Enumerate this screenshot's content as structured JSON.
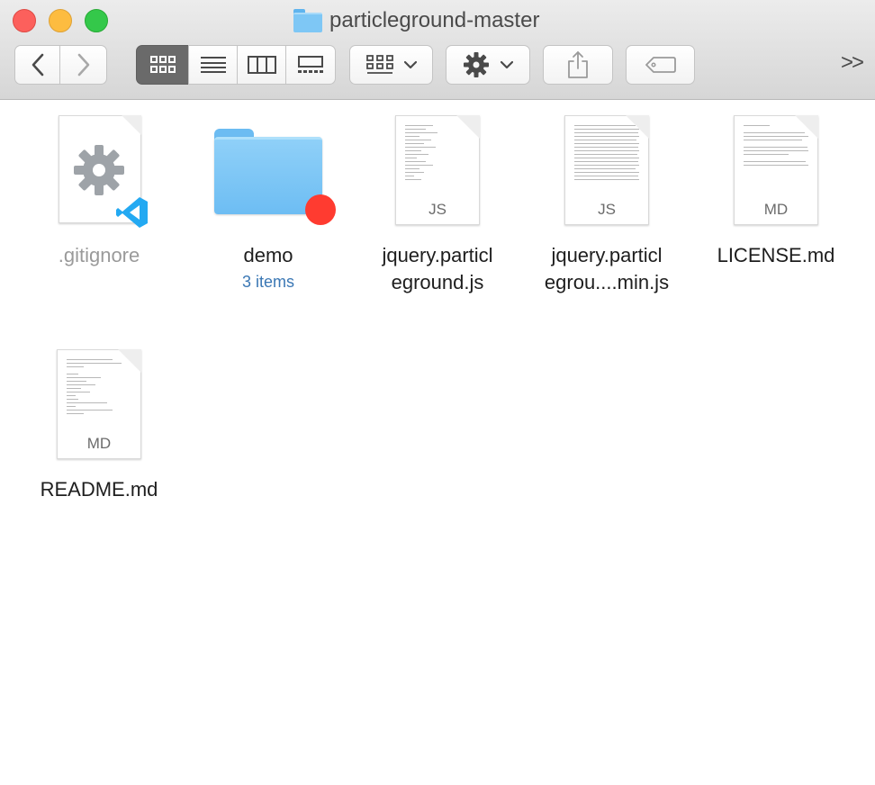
{
  "window": {
    "title": "particleground-master"
  },
  "toolbar": {
    "back_icon": "chevron-left-icon",
    "forward_icon": "chevron-right-icon",
    "view_modes": [
      "icon-view",
      "list-view",
      "column-view",
      "gallery-view"
    ],
    "active_view": "icon-view",
    "group_icon": "group-by-icon",
    "action_icon": "gear-icon",
    "share_icon": "share-icon",
    "tag_icon": "tag-icon",
    "overflow_label": ">>"
  },
  "files": [
    {
      "name": ".gitignore",
      "kind": "settings-file",
      "dimmed": true
    },
    {
      "name": "demo",
      "kind": "folder",
      "subtitle": "3 items",
      "tag_color": "#ff3b30"
    },
    {
      "name_line1": "jquery.particl",
      "name_line2": "eground.js",
      "kind": "document",
      "ext": "JS"
    },
    {
      "name_line1": "jquery.particl",
      "name_line2": "egrou....min.js",
      "kind": "document",
      "ext": "JS"
    },
    {
      "name": "LICENSE.md",
      "kind": "document",
      "ext": "MD"
    },
    {
      "name": "README.md",
      "kind": "document",
      "ext": "MD"
    }
  ],
  "colors": {
    "folder": "#7ec7f5",
    "close": "#fc605c",
    "minimize": "#fdbc40",
    "zoom": "#34c84a",
    "vscode_accent": "#23a9f2"
  }
}
